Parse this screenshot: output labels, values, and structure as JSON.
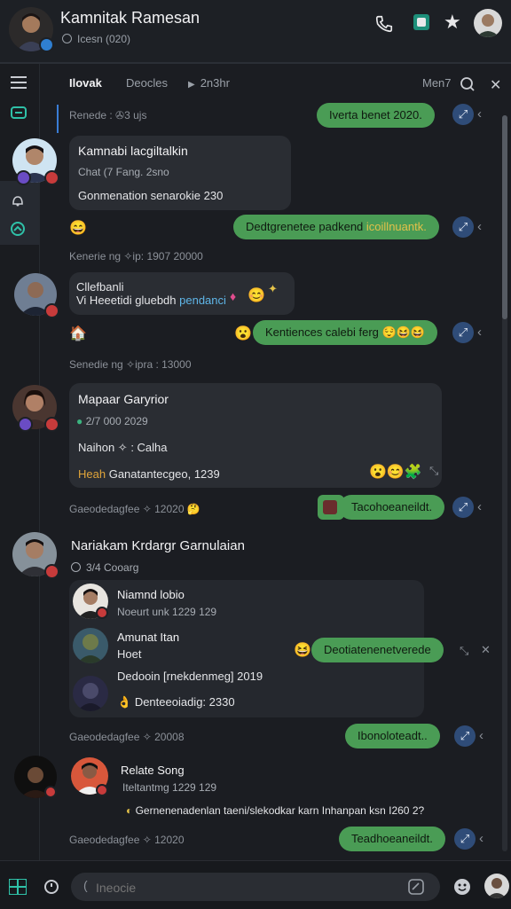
{
  "header": {
    "title": "Kamnitak Ramesan",
    "status": "Icesn (020)",
    "icons": [
      "phone-icon",
      "app-icon",
      "star-icon",
      "profile-icon"
    ]
  },
  "topbar": {
    "tabs": [
      "Ilovak",
      "Deocles",
      "2n3hr"
    ],
    "right_label": "Men7"
  },
  "sidebar": {
    "icons": [
      "menu-icon",
      "chat-icon",
      "bell-icon",
      "refresh-icon"
    ]
  },
  "messages": {
    "m1": {
      "meta": "Renede : ✇3 ujs",
      "reply": "Iverta benet 2020."
    },
    "m2": {
      "name": "Kamnabi lacgiltalkin",
      "line1": "Chat (7 Fang. 2sno",
      "line2": "Gonmenation senarokie 230"
    },
    "m3": {
      "reply_a": "Dedtgrenetee padkend",
      "reply_b": "icoillnuantk."
    },
    "m4": {
      "meta": "Kenerie ng ✧ip: 1907 20000",
      "line1": "Cllefbanli",
      "line2": "Vi Heeetidi gluebdh",
      "line2b": "pendanci"
    },
    "m5": {
      "reply": "Kentiences calebi ferg"
    },
    "m6": {
      "meta": "Senedie ng ✧ipra : 13000"
    },
    "m7": {
      "name": "Mapaar Garyrior",
      "line1": "2/7 000 2029",
      "line2": "Naihon ✧ : Calha",
      "line3a": "Heah",
      "line3b": "Ganatantecgeo, 1239"
    },
    "m8": {
      "meta": "Gaeodedagfee ✧ 12020",
      "reply": "Tacohoeaneildt."
    },
    "m9": {
      "name": "Nariakam Krdargr Garnulaian",
      "sub": "3/4 Cooarg"
    },
    "m10": {
      "name": "Niamnd lobio",
      "sub": "Noeurt unk 1229 129"
    },
    "m11": {
      "name": "Amunat Itan",
      "sub": "Hoet",
      "line": "Dedooin [rnekdenmeg] 2019",
      "reply": "Deotiatenenetverede"
    },
    "m12": {
      "line": "Denteeoiadig: 2330"
    },
    "m13": {
      "meta": "Gaeodedagfee ✧ 20008",
      "reply": "Ibonoloteadt.."
    },
    "m14": {
      "name": "Relate Song",
      "sub": "Iteltantmg 1229 129",
      "line": "Gernenenadenlan taeni/slekodkar karn Inhanpan ksn I260 2?"
    },
    "m15": {
      "meta": "Gaeodedagfee ✧ 12020",
      "reply": "Teadhoeaneildt."
    }
  },
  "composer": {
    "placeholder": "Ineocie"
  },
  "colors": {
    "accent_green": "#4a9c55",
    "link_blue": "#2f4c78",
    "background": "#1b1d22"
  }
}
